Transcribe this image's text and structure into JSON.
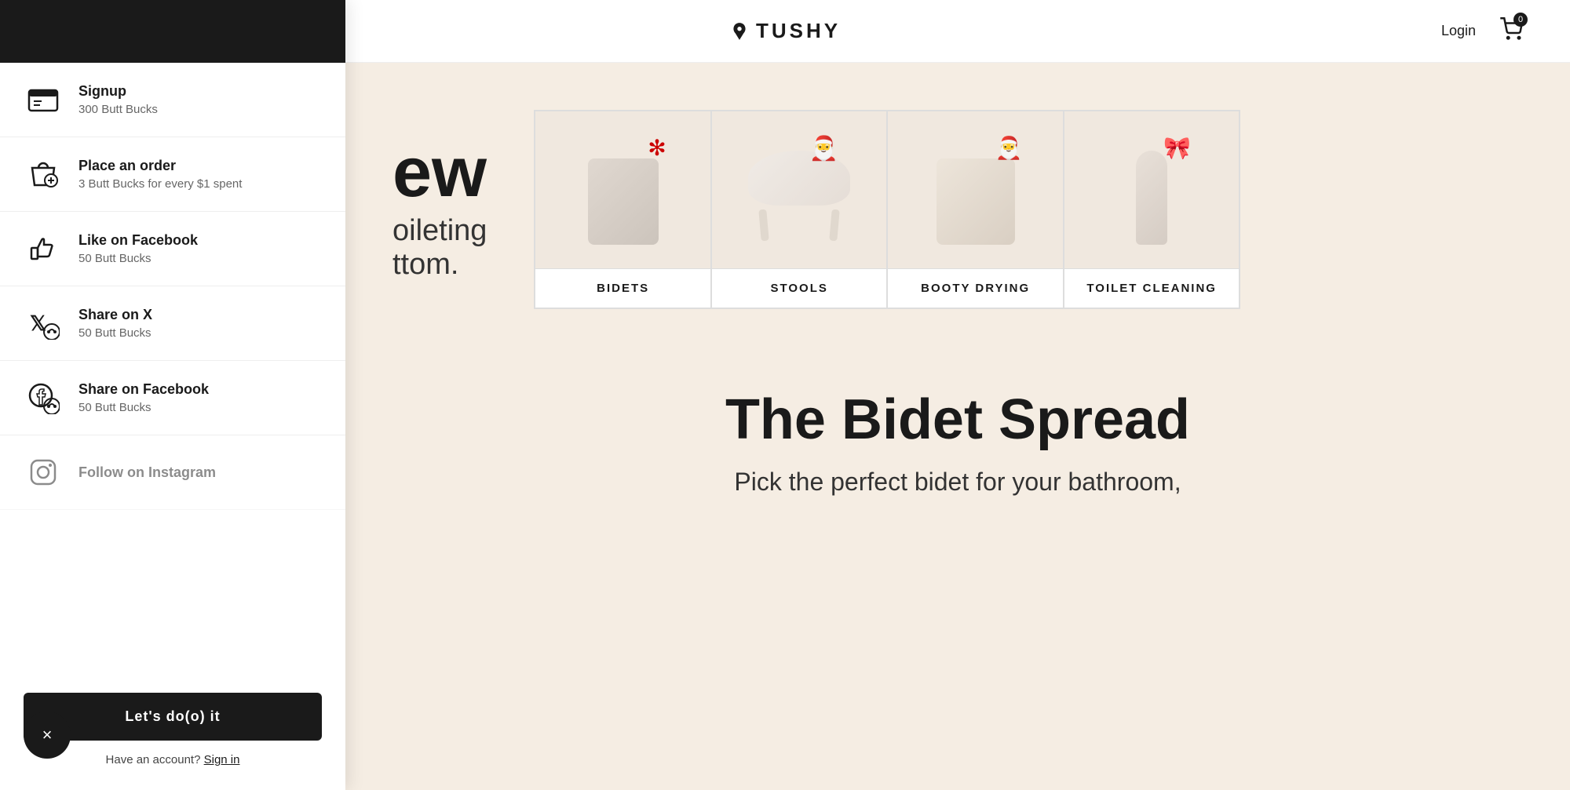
{
  "header": {
    "logo_text": "TUSHY",
    "login_label": "Login",
    "cart_count": "0"
  },
  "sidebar": {
    "items": [
      {
        "id": "signup",
        "title": "Signup",
        "subtitle": "300 Butt Bucks",
        "icon": "signup-icon"
      },
      {
        "id": "place-order",
        "title": "Place an order",
        "subtitle": "3 Butt Bucks for every $1 spent",
        "icon": "shopping-bag-icon"
      },
      {
        "id": "like-facebook",
        "title": "Like on Facebook",
        "subtitle": "50 Butt Bucks",
        "icon": "thumbs-up-icon"
      },
      {
        "id": "share-x",
        "title": "Share on X",
        "subtitle": "50 Butt Bucks",
        "icon": "x-icon"
      },
      {
        "id": "share-facebook",
        "title": "Share on Facebook",
        "subtitle": "50 Butt Bucks",
        "icon": "facebook-share-icon"
      },
      {
        "id": "follow-instagram",
        "title": "Follow on Instagram",
        "subtitle": "",
        "icon": "instagram-icon",
        "partial": true
      }
    ],
    "cta_button": "Let's do(o) it",
    "have_account_text": "Have an account?",
    "sign_in_label": "Sign in"
  },
  "categories": [
    {
      "label": "BIDETS"
    },
    {
      "label": "STOOLS"
    },
    {
      "label": "BOOTY DRYING"
    },
    {
      "label": "TOILET CLEANING"
    }
  ],
  "hero": {
    "title_part1": "ew",
    "subtitle_line1": "oileting",
    "subtitle_line2": "ttom."
  },
  "bidet_spread": {
    "title": "The Bidet Spread",
    "subtitle": "Pick the perfect bidet for your bathroom,"
  },
  "close_button": "×"
}
